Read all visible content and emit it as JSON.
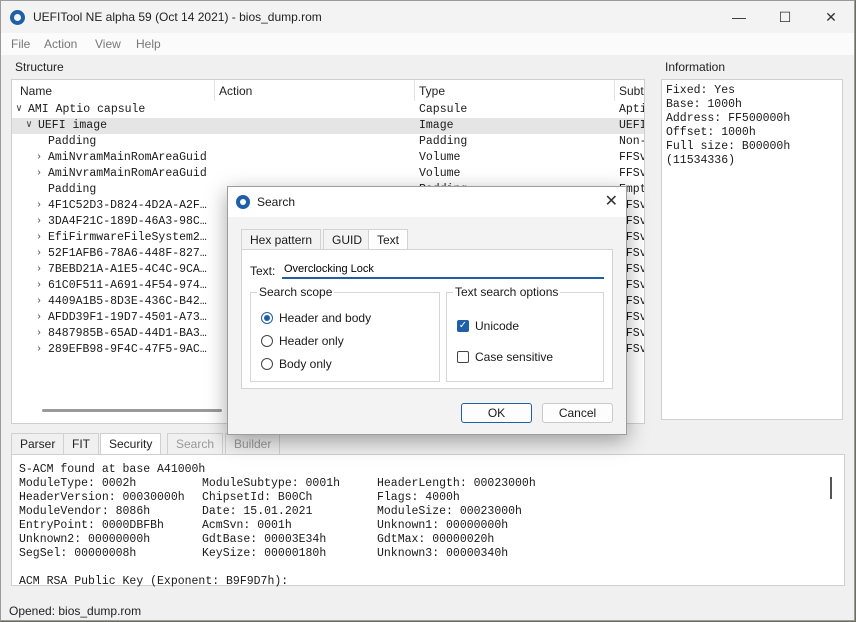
{
  "window": {
    "title": "UEFITool NE alpha 59 (Oct 14 2021) - bios_dump.rom",
    "minimize": "—",
    "maximize": "☐",
    "close": "✕"
  },
  "menu": [
    "File",
    "Action",
    "View",
    "Help"
  ],
  "structure": {
    "label": "Structure",
    "columns": [
      "Name",
      "Action",
      "Type",
      "Subt"
    ],
    "rows": [
      {
        "chev": "∨",
        "name": "AMI Aptio capsule",
        "action": "",
        "type": "Capsule",
        "subtype": "Apti"
      },
      {
        "chev": "∨",
        "name": "UEFI image",
        "action": "",
        "type": "Image",
        "subtype": "UEFI"
      },
      {
        "chev": "",
        "name": "Padding",
        "action": "",
        "type": "Padding",
        "subtype": "Non-"
      },
      {
        "chev": "›",
        "name": "AmiNvramMainRomAreaGuid",
        "action": "",
        "type": "Volume",
        "subtype": "FFSv"
      },
      {
        "chev": "›",
        "name": "AmiNvramMainRomAreaGuid",
        "action": "",
        "type": "Volume",
        "subtype": "FFSv"
      },
      {
        "chev": "",
        "name": "Padding",
        "action": "",
        "type": "Padding",
        "subtype": "Empt"
      },
      {
        "chev": "›",
        "name": "4F1C52D3-D824-4D2A-A2F…",
        "action": "",
        "type": "",
        "subtype": "FFSv"
      },
      {
        "chev": "›",
        "name": "3DA4F21C-189D-46A3-98C…",
        "action": "",
        "type": "",
        "subtype": "FFSv"
      },
      {
        "chev": "›",
        "name": "EfiFirmwareFileSystem2…",
        "action": "",
        "type": "",
        "subtype": "FFSv"
      },
      {
        "chev": "›",
        "name": "52F1AFB6-78A6-448F-827…",
        "action": "",
        "type": "",
        "subtype": "FFSv"
      },
      {
        "chev": "›",
        "name": "7BEBD21A-A1E5-4C4C-9CA…",
        "action": "",
        "type": "",
        "subtype": "FFSv"
      },
      {
        "chev": "›",
        "name": "61C0F511-A691-4F54-974…",
        "action": "",
        "type": "",
        "subtype": "FFSv"
      },
      {
        "chev": "›",
        "name": "4409A1B5-8D3E-436C-B42…",
        "action": "",
        "type": "",
        "subtype": "FFSv"
      },
      {
        "chev": "›",
        "name": "AFDD39F1-19D7-4501-A73…",
        "action": "",
        "type": "",
        "subtype": "FFSv"
      },
      {
        "chev": "›",
        "name": "8487985B-65AD-44D1-BA3…",
        "action": "",
        "type": "",
        "subtype": "FFSv"
      },
      {
        "chev": "›",
        "name": "289EFB98-9F4C-47F5-9AC…",
        "action": "",
        "type": "",
        "subtype": "FFSv"
      }
    ]
  },
  "information": {
    "label": "Information",
    "lines": [
      "Fixed: Yes",
      "Base: 1000h",
      "Address: FF500000h",
      "Offset: 1000h",
      "Full size: B00000h",
      "(11534336)"
    ]
  },
  "bottom_tabs": [
    "Parser",
    "FIT",
    "Security",
    "Search",
    "Builder"
  ],
  "security": {
    "header": "S-ACM found at base A41000h",
    "rows": [
      [
        "ModuleType: 0002h",
        "ModuleSubtype: 0001h",
        "HeaderLength: 00023000h"
      ],
      [
        "HeaderVersion: 00030000h",
        "ChipsetId:  B00Ch",
        "Flags: 4000h"
      ],
      [
        "ModuleVendor: 8086h",
        "Date: 15.01.2021",
        "ModuleSize: 00023000h"
      ],
      [
        "EntryPoint: 0000DBFBh",
        "AcmSvn: 0001h",
        "Unknown1: 00000000h"
      ],
      [
        "Unknown2: 00000000h",
        "GdtBase: 00003E34h",
        "GdtMax: 00000020h"
      ],
      [
        "SegSel: 00000008h",
        "KeySize: 00000180h",
        "Unknown3: 00000340h"
      ]
    ],
    "footer": "ACM RSA Public Key (Exponent: B9F9D7h):"
  },
  "status": "Opened: bios_dump.rom",
  "dialog": {
    "title": "Search",
    "close": "✕",
    "tabs": [
      "Hex pattern",
      "GUID",
      "Text"
    ],
    "text_label": "Text:",
    "text_value": "Overclocking Lock",
    "scope_title": "Search scope",
    "scope_options": [
      "Header and body",
      "Header only",
      "Body only"
    ],
    "options_title": "Text search options",
    "unicode_label": "Unicode",
    "case_label": "Case sensitive",
    "check_mark": "✓",
    "ok": "OK",
    "cancel": "Cancel"
  },
  "colors": {
    "accent": "#1f5fa8"
  }
}
